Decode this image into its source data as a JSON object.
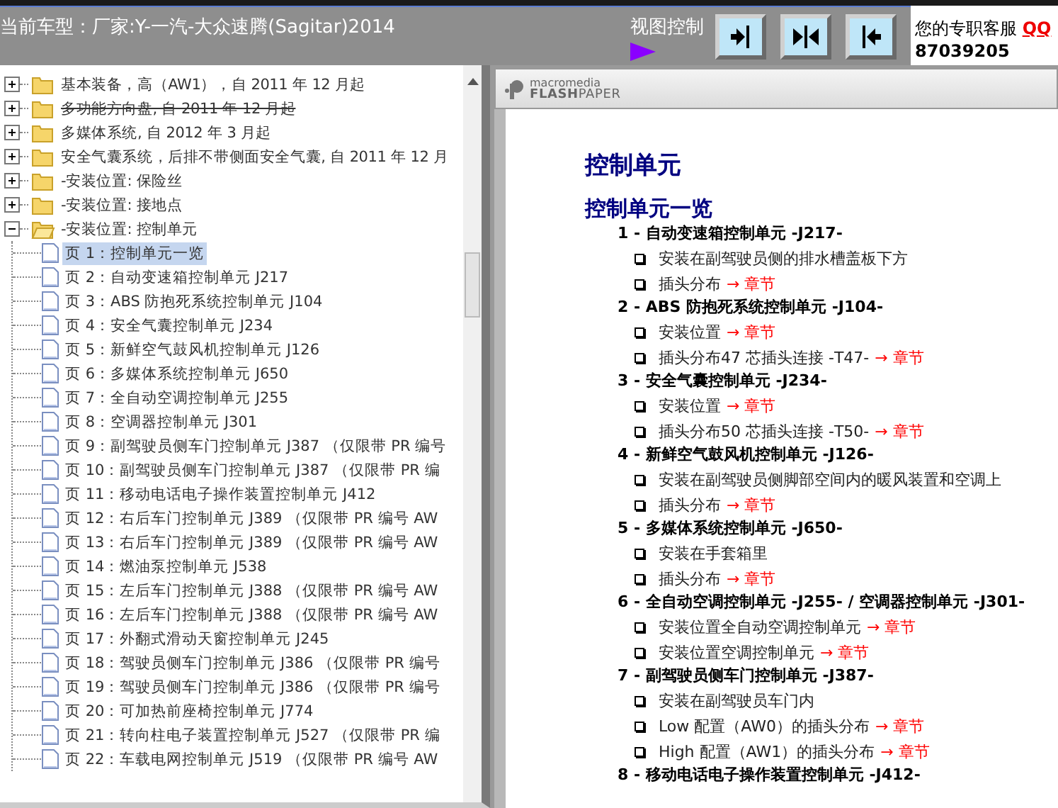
{
  "header": {
    "model_label": "当前车型：厂家:Y-一汽-大众速腾(Sagitar)2014",
    "view_control": "视图控制",
    "view_buttons": [
      {
        "kind": "right"
      },
      {
        "kind": "both"
      },
      {
        "kind": "left"
      }
    ],
    "service_label": "您的专职客服",
    "service_link": "QQ",
    "service_number": "87039205"
  },
  "tree": [
    {
      "label": "基本装备，高（AW1），自 2011 年 12 月起",
      "expanded": false,
      "struck": false
    },
    {
      "label": "多功能方向盘, 自 2011 年 12 月起",
      "expanded": false,
      "struck": true
    },
    {
      "label": "多媒体系统, 自 2012 年 3 月起",
      "expanded": false,
      "struck": false
    },
    {
      "label": "安全气囊系统，后排不带侧面安全气囊, 自 2011 年 12 月",
      "expanded": false,
      "struck": false
    },
    {
      "label": "-安装位置: 保险丝",
      "expanded": false,
      "struck": false
    },
    {
      "label": "-安装位置: 接地点",
      "expanded": false,
      "struck": false
    },
    {
      "label": "-安装位置: 控制单元",
      "expanded": true,
      "struck": false,
      "children": [
        {
          "label": "页 1：控制单元一览",
          "selected": true
        },
        {
          "label": "页 2：自动变速箱控制单元 J217",
          "selected": false
        },
        {
          "label": "页 3：ABS 防抱死系统控制单元 J104",
          "selected": false
        },
        {
          "label": "页 4：安全气囊控制单元 J234",
          "selected": false
        },
        {
          "label": "页 5：新鲜空气鼓风机控制单元 J126",
          "selected": false
        },
        {
          "label": "页 6：多媒体系统控制单元 J650",
          "selected": false
        },
        {
          "label": "页 7：全自动空调控制单元 J255",
          "selected": false
        },
        {
          "label": "页 8：空调器控制单元 J301",
          "selected": false
        },
        {
          "label": "页 9：副驾驶员侧车门控制单元 J387 （仅限带 PR 编号",
          "selected": false
        },
        {
          "label": "页 10：副驾驶员侧车门控制单元 J387 （仅限带 PR 编",
          "selected": false
        },
        {
          "label": "页 11：移动电话电子操作装置控制单元 J412",
          "selected": false
        },
        {
          "label": "页 12：右后车门控制单元 J389 （仅限带 PR 编号 AW",
          "selected": false
        },
        {
          "label": "页 13：右后车门控制单元 J389 （仅限带 PR 编号 AW",
          "selected": false
        },
        {
          "label": "页 14：燃油泵控制单元 J538",
          "selected": false
        },
        {
          "label": "页 15：左后车门控制单元 J388 （仅限带 PR 编号 AW",
          "selected": false
        },
        {
          "label": "页 16：左后车门控制单元 J388 （仅限带 PR 编号 AW",
          "selected": false
        },
        {
          "label": "页 17：外翻式滑动天窗控制单元 J245",
          "selected": false
        },
        {
          "label": "页 18：驾驶员侧车门控制单元 J386 （仅限带 PR 编号",
          "selected": false
        },
        {
          "label": "页 19：驾驶员侧车门控制单元 J386 （仅限带 PR 编号",
          "selected": false
        },
        {
          "label": "页 20：可加热前座椅控制单元 J774",
          "selected": false
        },
        {
          "label": "页 21：转向柱电子装置控制单元 J527 （仅限带 PR 编",
          "selected": false
        },
        {
          "label": "页 22：车载电网控制单元 J519 （仅限带 PR 编号 AW",
          "selected": false
        }
      ]
    }
  ],
  "viewer": {
    "logo_top": "macromedia",
    "logo_bottom": "**FLASH**PAPER",
    "title": "控制单元",
    "subtitle": "控制单元一览",
    "items": [
      {
        "heading": "1 - 自动变速箱控制单元 -J217-",
        "bullets": [
          {
            "text": "安装在副驾驶员侧的排水槽盖板下方"
          },
          {
            "text": "插头分布",
            "link": "→ 章节"
          }
        ]
      },
      {
        "heading": "2 - ABS 防抱死系统控制单元 -J104-",
        "bullets": [
          {
            "text": "安装位置",
            "link": "→ 章节"
          },
          {
            "text": "插头分布47 芯插头连接 -T47-",
            "link": "→ 章节"
          }
        ]
      },
      {
        "heading": "3 - 安全气囊控制单元 -J234-",
        "bullets": [
          {
            "text": "安装位置",
            "link": "→ 章节"
          },
          {
            "text": "插头分布50 芯插头连接 -T50-",
            "link": "→ 章节"
          }
        ]
      },
      {
        "heading": "4 - 新鲜空气鼓风机控制单元 -J126-",
        "bullets": [
          {
            "text": "安装在副驾驶员侧脚部空间内的暖风装置和空调上"
          },
          {
            "text": "插头分布",
            "link": "→ 章节"
          }
        ]
      },
      {
        "heading": "5 - 多媒体系统控制单元 -J650-",
        "bullets": [
          {
            "text": "安装在手套箱里"
          },
          {
            "text": "插头分布",
            "link": "→ 章节"
          }
        ]
      },
      {
        "heading": "6 - 全自动空调控制单元 -J255- / 空调器控制单元 -J301-",
        "bullets": [
          {
            "text": "安装位置全自动空调控制单元",
            "link": "→ 章节"
          },
          {
            "text": "安装位置空调控制单元",
            "link": "→ 章节"
          }
        ]
      },
      {
        "heading": "7 - 副驾驶员侧车门控制单元 -J387-",
        "bullets": [
          {
            "text": "安装在副驾驶员车门内"
          },
          {
            "text": "Low 配置（AW0）的插头分布",
            "link": "→ 章节"
          },
          {
            "text": "High 配置（AW1）的插头分布",
            "link": "→ 章节"
          }
        ]
      },
      {
        "heading": "8 - 移动电话电子操作装置控制单元 -J412-"
      }
    ]
  }
}
